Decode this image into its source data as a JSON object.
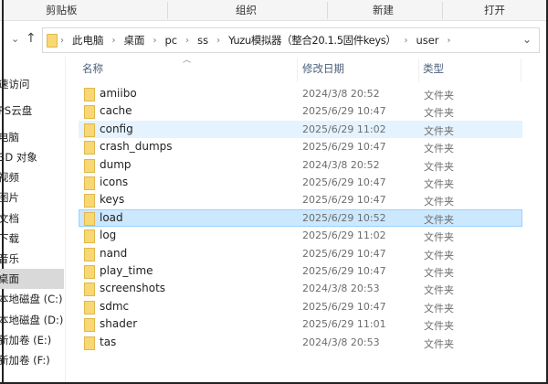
{
  "ribbon": {
    "groups": [
      "剪贴板",
      "组织",
      "新建",
      "打开"
    ]
  },
  "nav": {
    "recent": "⌄",
    "up": "↑"
  },
  "address": {
    "crumbs": [
      "此电脑",
      "桌面",
      "pc",
      "ss",
      "Yuzu模拟器（整合20.1.5固件keys）",
      "user"
    ],
    "dropdown": "⌄"
  },
  "sidebar": {
    "items": [
      "速访问",
      "PS云盘",
      "电脑",
      "3D 对象",
      "视频",
      "图片",
      "文档",
      "下载",
      "音乐",
      "桌面",
      "本地磁盘 (C:)",
      "本地磁盘 (D:)",
      "新加卷 (E:)",
      "新加卷 (F:)"
    ],
    "selected": "桌面"
  },
  "columns": {
    "name": "名称",
    "date": "修改日期",
    "type": "类型"
  },
  "files": [
    {
      "name": "amiibo",
      "date": "2024/3/8 20:52",
      "type": "文件夹"
    },
    {
      "name": "cache",
      "date": "2025/6/29 10:47",
      "type": "文件夹"
    },
    {
      "name": "config",
      "date": "2025/6/29 11:02",
      "type": "文件夹"
    },
    {
      "name": "crash_dumps",
      "date": "2025/6/29 10:47",
      "type": "文件夹"
    },
    {
      "name": "dump",
      "date": "2024/3/8 20:52",
      "type": "文件夹"
    },
    {
      "name": "icons",
      "date": "2025/6/29 10:47",
      "type": "文件夹"
    },
    {
      "name": "keys",
      "date": "2025/6/29 10:47",
      "type": "文件夹"
    },
    {
      "name": "load",
      "date": "2025/6/29 10:52",
      "type": "文件夹"
    },
    {
      "name": "log",
      "date": "2025/6/29 11:02",
      "type": "文件夹"
    },
    {
      "name": "nand",
      "date": "2025/6/29 10:47",
      "type": "文件夹"
    },
    {
      "name": "play_time",
      "date": "2025/6/29 10:47",
      "type": "文件夹"
    },
    {
      "name": "screenshots",
      "date": "2024/3/8 20:53",
      "type": "文件夹"
    },
    {
      "name": "sdmc",
      "date": "2025/6/29 10:47",
      "type": "文件夹"
    },
    {
      "name": "shader",
      "date": "2025/6/29 11:01",
      "type": "文件夹"
    },
    {
      "name": "tas",
      "date": "2024/3/8 20:53",
      "type": "文件夹"
    }
  ],
  "selected_file": "load",
  "hovered_file": "config"
}
